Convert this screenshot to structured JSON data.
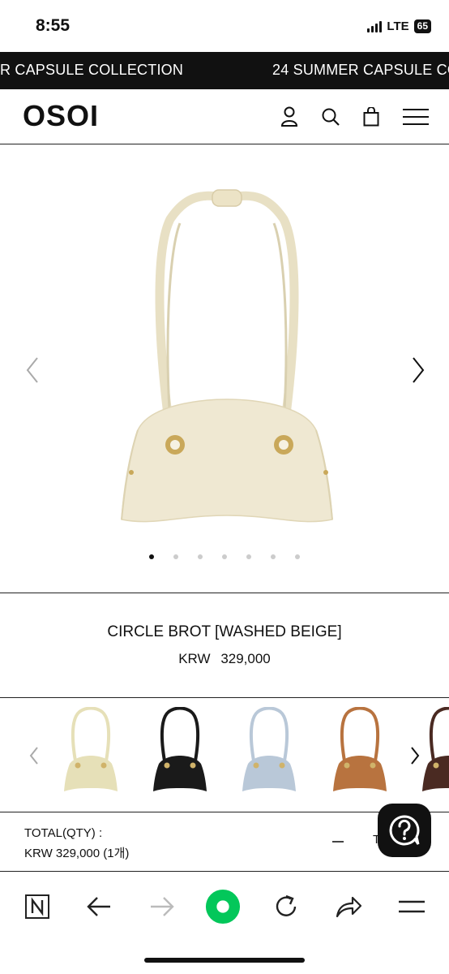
{
  "status_bar": {
    "time": "8:55",
    "network": "LTE",
    "battery": "65"
  },
  "marquee": {
    "text_left": "R CAPSULE COLLECTION",
    "text_right": "24 SUMMER CAPSULE CO"
  },
  "header": {
    "logo": "OSOI",
    "icons": [
      "user-icon",
      "search-icon",
      "shopping-bag-icon",
      "hamburger-menu-icon"
    ]
  },
  "gallery": {
    "image": "beige-shoulder-bag",
    "slide_index": 1,
    "slide_count": 7
  },
  "product": {
    "name": "CIRCLE BROT [WASHED BEIGE]",
    "currency": "KRW",
    "price": "329,000"
  },
  "swatches": [
    {
      "color_name": "washed beige",
      "color": "#e6e0b8"
    },
    {
      "color_name": "black",
      "color": "#1a1a1a"
    },
    {
      "color_name": "light blue",
      "color": "#b9c8d8"
    },
    {
      "color_name": "tan",
      "color": "#b8733f"
    },
    {
      "color_name": "brown",
      "color": "#4a2a22"
    }
  ],
  "total": {
    "label": "TOTAL(QTY) :",
    "value": "KRW 329,000 (1개)",
    "partial": "T"
  },
  "toolbar": {
    "icons": [
      "naver-icon",
      "back-arrow-icon",
      "forward-arrow-icon",
      "green-home-icon",
      "refresh-icon",
      "share-icon",
      "menu-icon"
    ]
  },
  "colors": {
    "accent": "#111111",
    "green": "#03c75a",
    "beige": "#efe8d2"
  }
}
